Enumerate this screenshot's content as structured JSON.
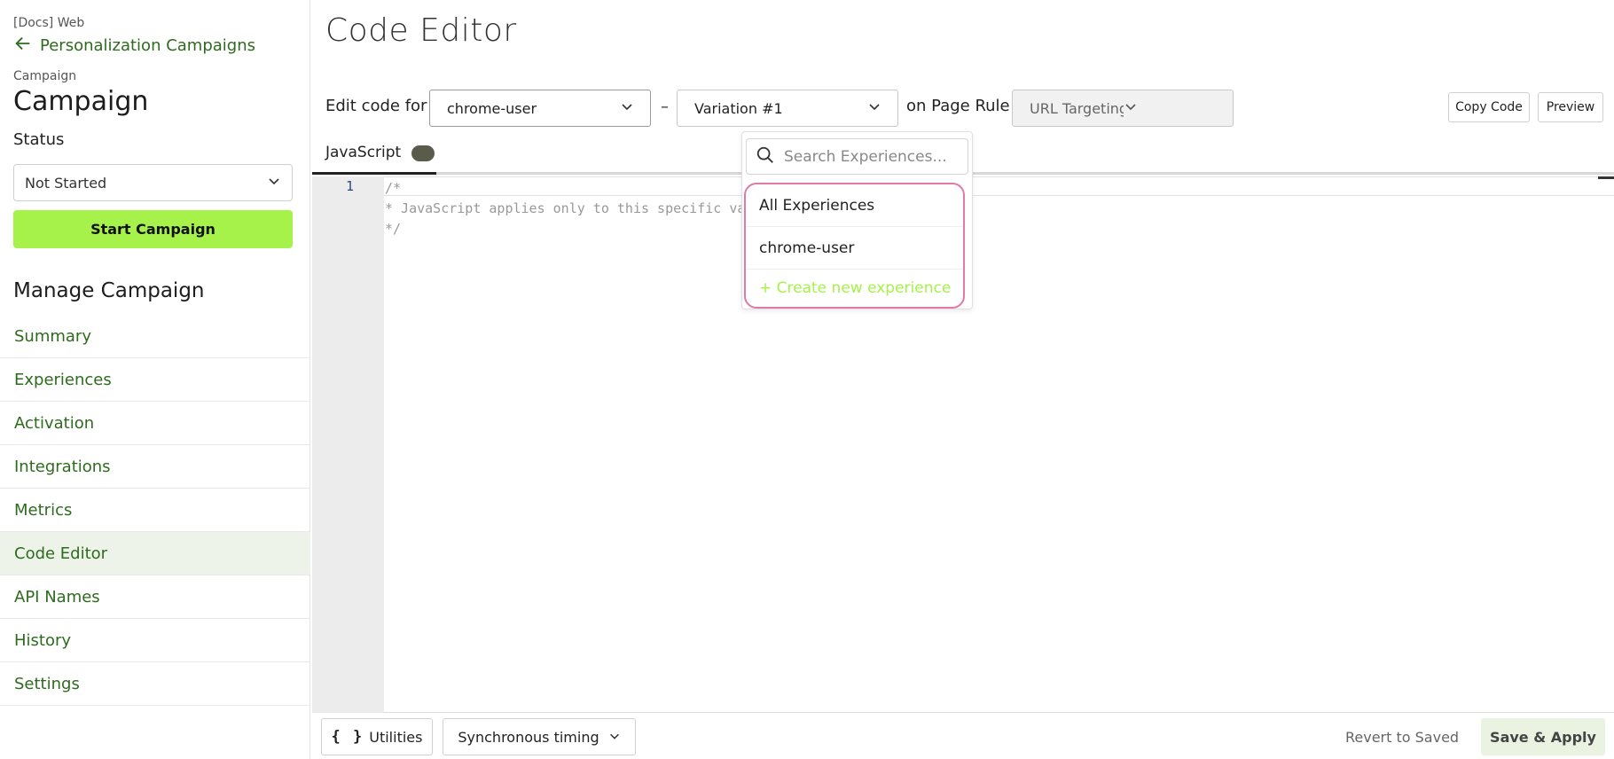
{
  "sidebar": {
    "org": "[Docs] Web",
    "back_label": "Personalization Campaigns",
    "campaign_small": "Campaign",
    "campaign_title": "Campaign",
    "status_label": "Status",
    "status_value": "Not Started",
    "start_button": "Start Campaign",
    "manage_heading": "Manage Campaign",
    "items": [
      {
        "label": "Summary"
      },
      {
        "label": "Experiences"
      },
      {
        "label": "Activation"
      },
      {
        "label": "Integrations"
      },
      {
        "label": "Metrics"
      },
      {
        "label": "Code Editor"
      },
      {
        "label": "API Names"
      },
      {
        "label": "History"
      },
      {
        "label": "Settings"
      }
    ],
    "active_item": "Code Editor"
  },
  "main": {
    "title": "Code Editor",
    "edit_code_for_label": "Edit code for",
    "experience_value": "chrome-user",
    "dash": "–",
    "variation_value": "Variation #1",
    "on_page_rule_label": "on Page Rule",
    "page_rule_value": "URL Targeting for Campaign",
    "copy_code_button": "Copy Code",
    "preview_button": "Preview",
    "tab_js_label": "JavaScript",
    "editor": {
      "line_number": "1",
      "code_lines": [
        "/*",
        "* JavaScript applies only to this specific variation.",
        "*/"
      ]
    }
  },
  "dropdown": {
    "search_placeholder": "Search Experiences...",
    "items": [
      {
        "label": "All Experiences"
      },
      {
        "label": "chrome-user"
      }
    ],
    "create_label": "+ Create new experience"
  },
  "bottom": {
    "utilities_icon": "{ }",
    "utilities_button": "Utilities",
    "timing_button": "Synchronous timing",
    "revert_link": "Revert to Saved",
    "save_button": "Save & Apply"
  },
  "colors": {
    "accent_link": "#2d6b1e",
    "start_button": "#a6f24a",
    "dropdown_highlight": "#e27aa6",
    "active_nav_bg": "#eef3ea"
  },
  "icons": [
    "arrow-left-icon",
    "chevron-down-icon",
    "search-icon",
    "braces-icon"
  ]
}
